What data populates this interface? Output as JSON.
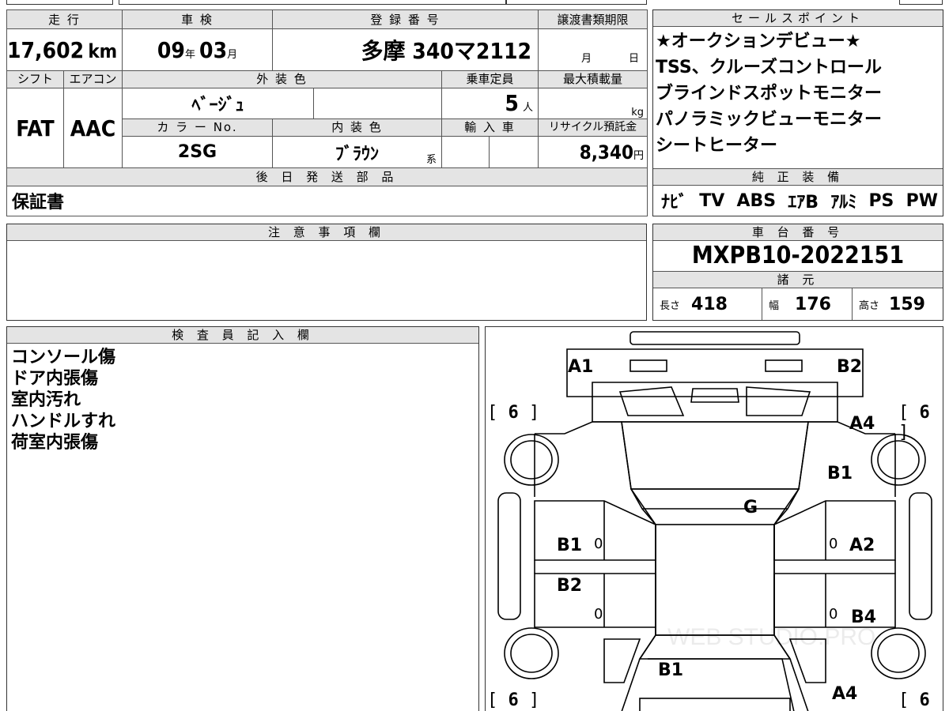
{
  "vehicle": {
    "mileage_label": "走 行",
    "mileage_value": "17,602",
    "mileage_unit": "km",
    "inspection_label": "車 検",
    "inspection_year": "09",
    "inspection_year_unit": "年",
    "inspection_month": "03",
    "inspection_month_unit": "月",
    "registration_label": "登 録 番 号",
    "registration_value": "多摩 340マ2112",
    "transfer_label": "譲渡書類期限",
    "transfer_month_unit": "月",
    "transfer_day_unit": "日",
    "shift_label": "シフト",
    "shift_value": "FAT",
    "ac_label": "エアコン",
    "ac_value": "AAC",
    "exterior_label": "外 装 色",
    "exterior_value": "ﾍﾞｰｼﾞｭ",
    "capacity_label": "乗車定員",
    "capacity_value": "5",
    "capacity_unit": "人",
    "maxload_label": "最大積載量",
    "maxload_unit": "kg",
    "color_no_label": "カ ラ ー No.",
    "color_no_value": "2SG",
    "interior_label": "内 装 色",
    "interior_value": "ﾌﾞﾗｳﾝ",
    "interior_suffix": "系",
    "import_label": "輸 入 車",
    "recycle_label": "リサイクル預託金",
    "recycle_value": "8,340",
    "recycle_unit": "円",
    "later_parts_label": "後 日 発 送 部 品",
    "later_parts_value": "保証書"
  },
  "sales_points": {
    "label": "セールスポイント",
    "lines": [
      "★オークションデビュー★",
      "TSS、クルーズコントロール",
      "ブラインドスポットモニター",
      "パノラミックビューモニター",
      "シートヒーター"
    ]
  },
  "equipment": {
    "label": "純 正 装 備",
    "items": [
      "ﾅﾋﾞ",
      "TV",
      "ABS",
      "ｴｱB",
      "ｱﾙﾐ",
      "PS",
      "PW"
    ]
  },
  "caution": {
    "label": "注 意 事 項 欄"
  },
  "chassis": {
    "label": "車 台 番 号",
    "value": "MXPB10-2022151",
    "spec_label": "諸 元",
    "length_label": "長さ",
    "length_value": "418",
    "width_label": "幅",
    "width_value": "176",
    "height_label": "高さ",
    "height_value": "159"
  },
  "inspector": {
    "label": "検 査 員 記 入 欄",
    "notes": [
      "コンソール傷",
      "ドア内張傷",
      "室内汚れ",
      "ハンドルすれ",
      "荷室内張傷"
    ]
  },
  "diagram": {
    "labels": {
      "front_left": "A1",
      "front_right": "B2",
      "right_front_fender": "A4",
      "right_front_door_upper": "B1",
      "glass": "G",
      "left_front_door": "B1",
      "right_front_door": "A2",
      "left_rear_door": "B2",
      "right_rear_door": "B4",
      "rear_center": "B1",
      "right_rear_fender": "A4"
    },
    "tire_tl": "6",
    "tire_tr": "6",
    "tire_bl": "6",
    "tire_br": "6",
    "zero": "0",
    "watermark": "WEB STUDIO.PRO"
  }
}
